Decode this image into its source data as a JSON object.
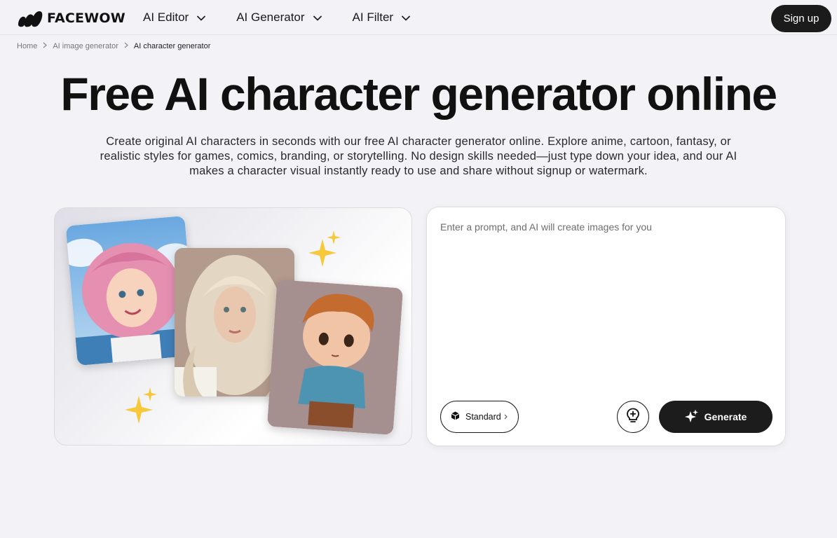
{
  "header": {
    "brand": "FACEWOW",
    "nav": [
      {
        "label": "AI Editor"
      },
      {
        "label": "AI Generator"
      },
      {
        "label": "AI Filter"
      }
    ],
    "signup_label": "Sign up"
  },
  "breadcrumb": {
    "items": [
      "Home",
      "AI image generator",
      "AI character generator"
    ]
  },
  "hero": {
    "title": "Free AI character generator online",
    "subtitle": "Create original AI characters in seconds with our free AI character generator online. Explore anime, cartoon, fantasy, or realistic styles for games, comics, branding, or storytelling. No design skills needed—just type down your idea, and our AI makes a character visual instantly ready to use and share without signup or watermark."
  },
  "prompt": {
    "placeholder": "Enter a prompt, and AI will create images for you",
    "value": "",
    "model_label": "Standard",
    "generate_label": "Generate"
  },
  "icons": {
    "logo": "facewow-logo-icon",
    "chevron": "chevron-down-icon",
    "cube": "cube-icon",
    "bulb": "lightbulb-plus-icon",
    "sparkle": "sparkle-icon"
  },
  "colors": {
    "background": "#f3f2f6",
    "primary_button": "#1b1b1b",
    "sparkle": "#f5c93a"
  }
}
